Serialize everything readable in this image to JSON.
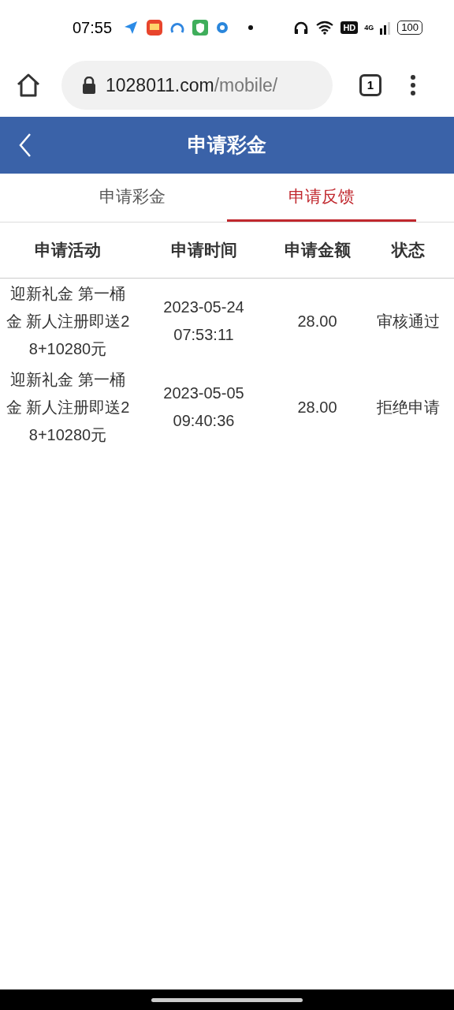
{
  "status_bar": {
    "time": "07:55",
    "network": "4G",
    "hd": "HD",
    "battery": "100"
  },
  "browser": {
    "url_host": "1028011.com",
    "url_path": "/mobile/",
    "tab_count": "1"
  },
  "header": {
    "title": "申请彩金"
  },
  "tabs": [
    {
      "label": "申请彩金",
      "selected": false
    },
    {
      "label": "申请反馈",
      "selected": true
    }
  ],
  "table": {
    "columns": [
      "申请活动",
      "申请时间",
      "申请金额",
      "状态"
    ],
    "rows": [
      [
        "迎新礼金 第一桶金 新人注册即送28+10280元",
        "2023-05-24 07:53:11",
        "28.00",
        "审核通过"
      ],
      [
        "迎新礼金 第一桶金 新人注册即送28+10280元",
        "2023-05-05 09:40:36",
        "28.00",
        "拒绝申请"
      ]
    ]
  }
}
